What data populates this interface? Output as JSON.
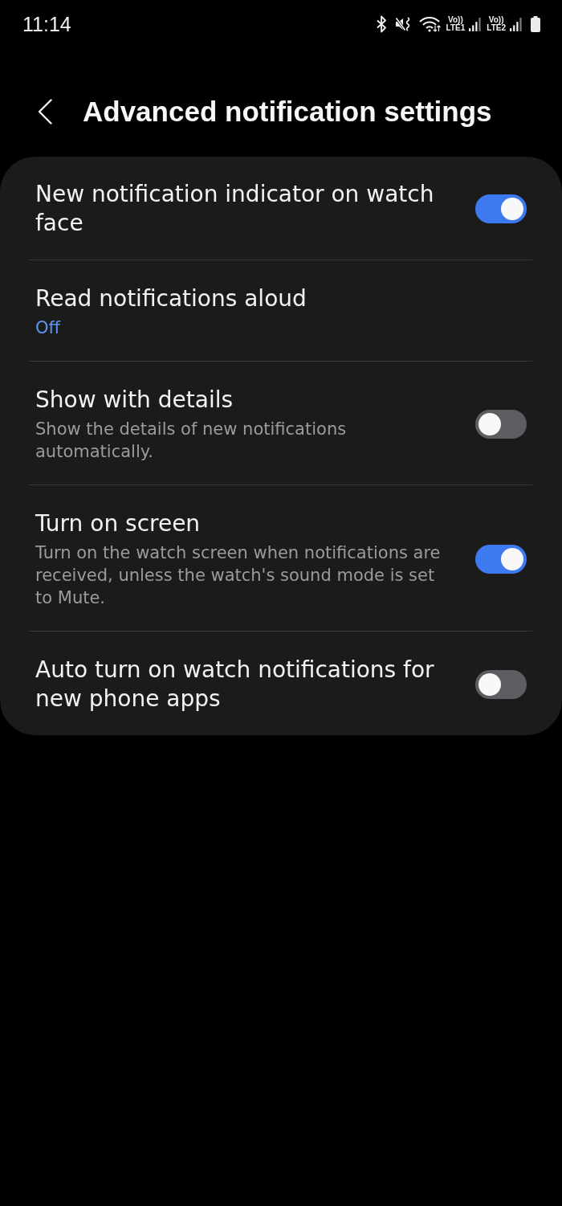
{
  "status_bar": {
    "time": "11:14",
    "sims": [
      {
        "voice": "Vo))",
        "network": "LTE1"
      },
      {
        "voice": "Vo))",
        "network": "LTE2"
      }
    ]
  },
  "header": {
    "title": "Advanced notification settings"
  },
  "settings": [
    {
      "kind": "toggle",
      "title": "New notification indicator on watch face",
      "on": true
    },
    {
      "kind": "value",
      "title": "Read notifications aloud",
      "value": "Off"
    },
    {
      "kind": "toggle",
      "title": "Show with details",
      "description": "Show the details of new notifications automatically.",
      "on": false
    },
    {
      "kind": "toggle",
      "title": "Turn on screen",
      "description": "Turn on the watch screen when notifications are received, unless the watch's sound mode is set to Mute.",
      "on": true
    },
    {
      "kind": "toggle",
      "title": "Auto turn on watch notifications for new phone apps",
      "on": false
    }
  ]
}
